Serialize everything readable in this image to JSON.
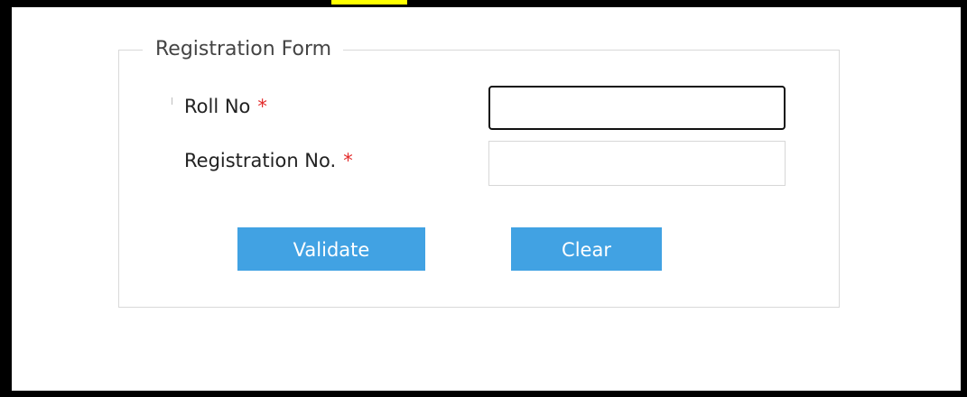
{
  "form": {
    "legend": "Registration Form",
    "roll_no": {
      "label": "Roll No",
      "required_marker": "*",
      "value": ""
    },
    "registration_no": {
      "label": "Registration No.",
      "required_marker": "*",
      "value": ""
    },
    "buttons": {
      "validate_label": "Validate",
      "clear_label": "Clear"
    }
  },
  "colors": {
    "button_bg": "#41a2e3",
    "required_asterisk": "#e32b2b",
    "highlight": "#ffff00",
    "frame": "#000000"
  }
}
